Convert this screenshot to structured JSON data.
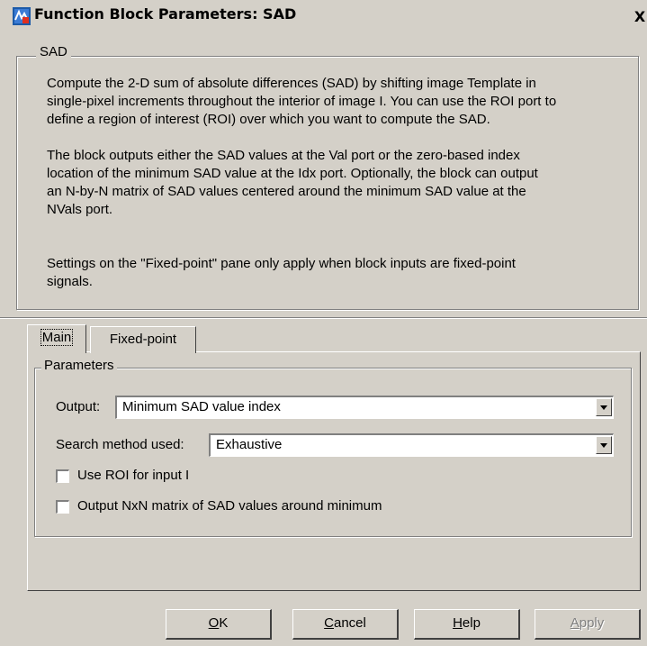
{
  "window": {
    "title": "Function Block Parameters: SAD",
    "close_label": "X"
  },
  "description": {
    "group_title": "SAD",
    "paragraphs": [
      "Compute the 2-D sum of absolute differences (SAD) by shifting image Template  in\nsingle-pixel increments throughout the interior of image I. You can use the ROI port to\ndefine a region of interest (ROI) over which you want to compute the SAD.",
      "The block outputs either the SAD values at the Val port or the zero-based index\nlocation of the minimum SAD value at the Idx port.  Optionally, the block can output\nan N-by-N matrix of SAD values centered around the minimum SAD value at the\nNVals port.",
      "Settings on the \"Fixed-point\" pane only apply when block inputs are fixed-point\nsignals."
    ]
  },
  "tabs": [
    {
      "label": "Main",
      "active": true
    },
    {
      "label": "Fixed-point",
      "active": false
    }
  ],
  "parameters": {
    "group_title": "Parameters",
    "output_label": "Output:",
    "output_value": "Minimum SAD value index",
    "search_label": "Search method used:",
    "search_value": "Exhaustive",
    "roi_label": "Use ROI for input I",
    "roi_checked": false,
    "nxn_label": "Output NxN matrix of SAD values around minimum",
    "nxn_checked": false
  },
  "buttons": {
    "ok": {
      "mnemonic": "O",
      "rest": "K"
    },
    "cancel": {
      "mnemonic": "C",
      "rest": "ancel"
    },
    "help": {
      "mnemonic": "H",
      "rest": "elp"
    },
    "apply": {
      "mnemonic": "A",
      "rest": "pply",
      "enabled": false
    }
  },
  "colors": {
    "dialog_face": "#d4d0c8",
    "disabled_text": "#808080"
  },
  "icons": {
    "title_icon": "simulink-block-icon",
    "combo_arrow": "chevron-down-icon"
  }
}
